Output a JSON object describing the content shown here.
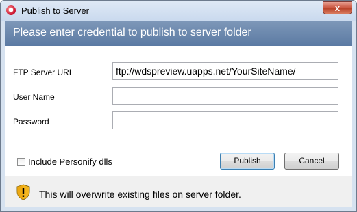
{
  "window": {
    "title": "Publish to Server",
    "close_label": "x",
    "app_icon": "application-logo-icon"
  },
  "header": {
    "text": "Please enter credential to publish to server folder"
  },
  "form": {
    "ftp_label": "FTP Server URI",
    "ftp_value": "ftp://wdspreview.uapps.net/YourSiteName/",
    "username_label": "User Name",
    "username_value": "",
    "password_label": "Password",
    "password_value": ""
  },
  "options": {
    "include_label": "Include Personify dlls",
    "include_checked": false
  },
  "buttons": {
    "publish": "Publish",
    "cancel": "Cancel"
  },
  "footer": {
    "icon": "shield-warning-icon",
    "message": "This will overwrite existing files on server folder."
  },
  "colors": {
    "header_band": "#6784ab",
    "close_button": "#c9533d",
    "footer_bg": "#f0f0f0"
  }
}
